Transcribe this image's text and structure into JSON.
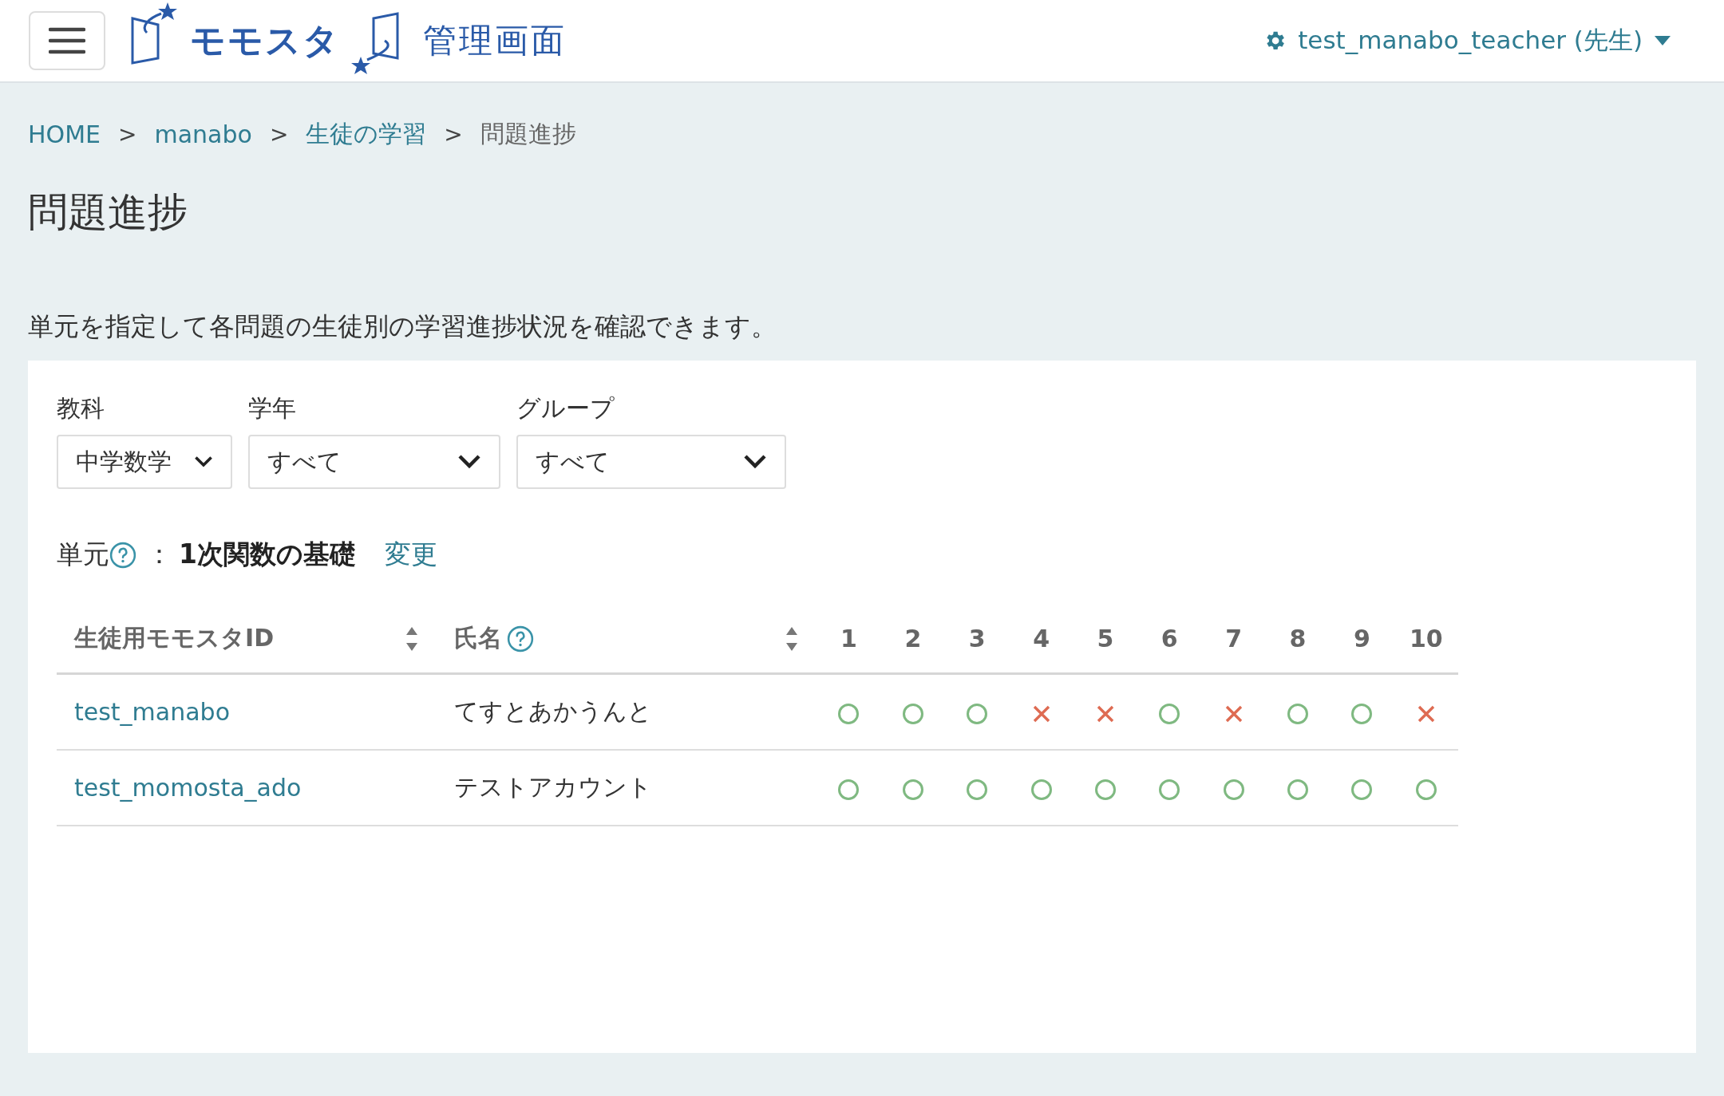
{
  "header": {
    "logo_text": "モモスタ",
    "logo_suffix": "管理画面",
    "user": "test_manabo_teacher (先生)"
  },
  "breadcrumb": [
    {
      "label": "HOME",
      "link": true
    },
    {
      "label": "manabo",
      "link": true
    },
    {
      "label": "生徒の学習",
      "link": true
    },
    {
      "label": "問題進捗",
      "link": false
    }
  ],
  "breadcrumb_separator": ">",
  "title": "問題進捗",
  "description": "単元を指定して各問題の生徒別の学習進捗状況を確認できます。",
  "filters": [
    {
      "label": "教科",
      "value": "中学数学"
    },
    {
      "label": "学年",
      "value": "すべて"
    },
    {
      "label": "グループ",
      "value": "すべて"
    }
  ],
  "unit": {
    "label": "単元",
    "separator": "：",
    "value": "1次関数の基礎",
    "change_link": "変更"
  },
  "table": {
    "columns": [
      {
        "label": "生徒用モモスタID",
        "sortable": true,
        "help": false
      },
      {
        "label": "氏名",
        "sortable": true,
        "help": true
      }
    ],
    "question_numbers": [
      "1",
      "2",
      "3",
      "4",
      "5",
      "6",
      "7",
      "8",
      "9",
      "10"
    ],
    "rows": [
      {
        "id": "test_manabo",
        "name": "てすとあかうんと",
        "results": [
          {
            "correct": true
          },
          {
            "correct": true
          },
          {
            "correct": true
          },
          {
            "correct": false
          },
          {
            "correct": false
          },
          {
            "correct": true
          },
          {
            "correct": false
          },
          {
            "correct": true
          },
          {
            "correct": true
          },
          {
            "correct": false
          }
        ]
      },
      {
        "id": "test_momosta_ado",
        "name": "テストアカウント",
        "results": [
          {
            "correct": true
          },
          {
            "correct": true
          },
          {
            "correct": true
          },
          {
            "correct": true
          },
          {
            "correct": true
          },
          {
            "correct": true
          },
          {
            "correct": true
          },
          {
            "correct": true
          },
          {
            "correct": true
          },
          {
            "correct": true
          }
        ]
      }
    ]
  }
}
